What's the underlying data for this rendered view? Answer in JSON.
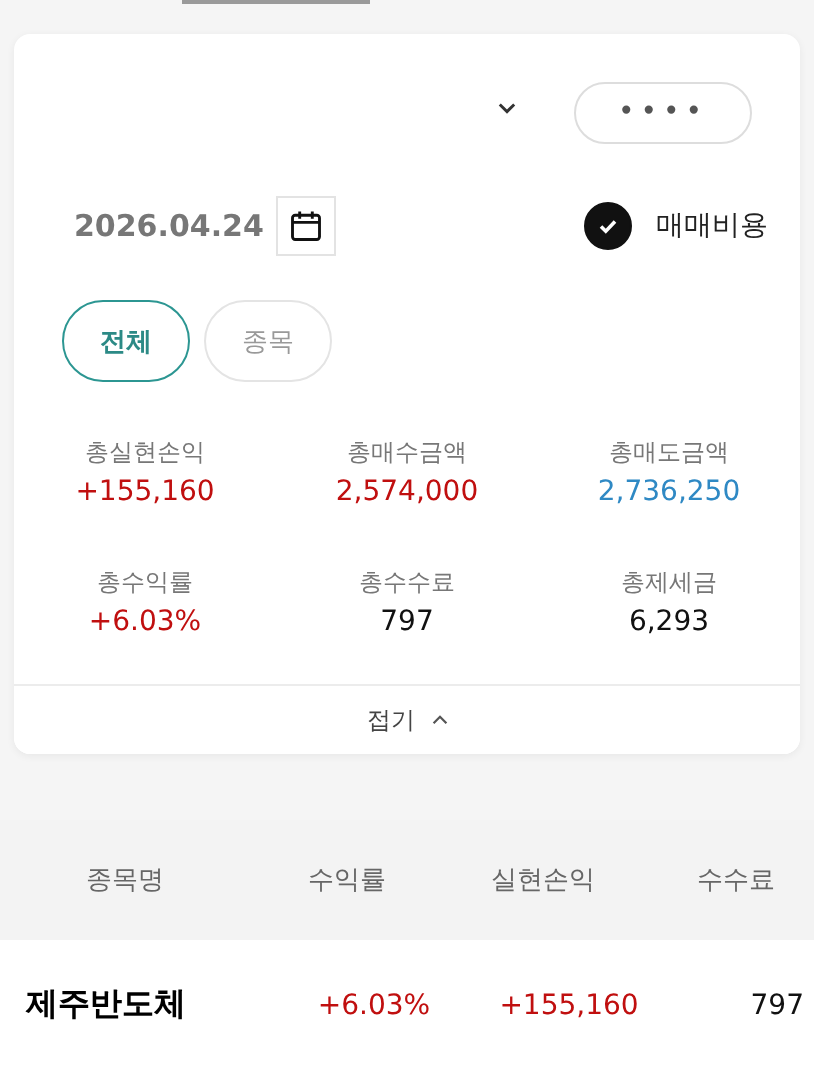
{
  "account": {
    "masked_value": "••••"
  },
  "date": "2026.04.24",
  "cost_option": {
    "label": "매매비용",
    "checked": true
  },
  "tabs": [
    {
      "label": "전체",
      "selected": true
    },
    {
      "label": "종목",
      "selected": false
    }
  ],
  "summary": [
    {
      "label": "총실현손익",
      "value": "+155,160",
      "color": "#c00f0f"
    },
    {
      "label": "총매수금액",
      "value": "2,574,000",
      "color": "#c00f0f"
    },
    {
      "label": "총매도금액",
      "value": "2,736,250",
      "color": "#2f89c4"
    },
    {
      "label": "총수익률",
      "value": "+6.03%",
      "color": "#c00f0f"
    },
    {
      "label": "총수수료",
      "value": "797",
      "color": "#111111"
    },
    {
      "label": "총제세금",
      "value": "6,293",
      "color": "#111111"
    }
  ],
  "collapse": {
    "label": "접기",
    "expanded": true
  },
  "table": {
    "columns": [
      "종목명",
      "수익률",
      "실현손익",
      "수수료"
    ],
    "rows": [
      {
        "cells": [
          {
            "text": "제주반도체",
            "color": "#000000"
          },
          {
            "text": "+6.03%",
            "color": "#c00f0f"
          },
          {
            "text": "+155,160",
            "color": "#c00f0f"
          },
          {
            "text": "797",
            "color": "#111111"
          }
        ]
      }
    ]
  }
}
